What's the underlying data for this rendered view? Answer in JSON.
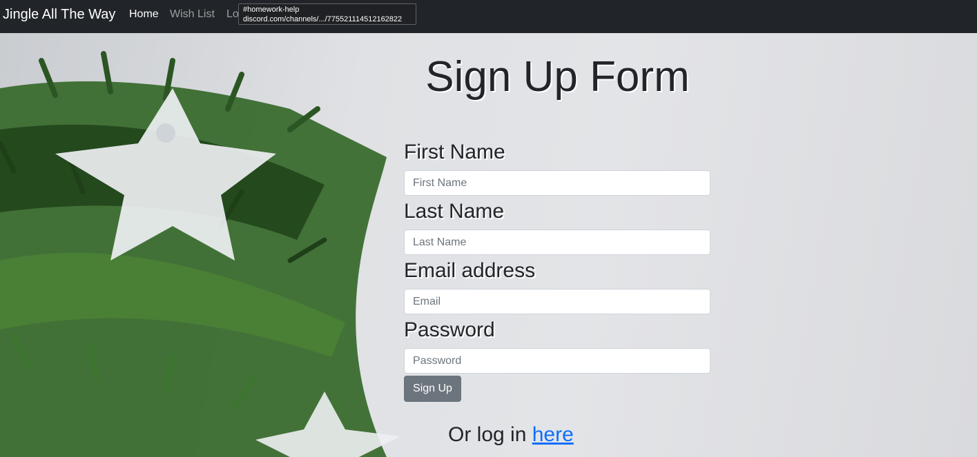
{
  "nav": {
    "brand": "Jingle All The Way",
    "links": [
      {
        "label": "Home",
        "active": true
      },
      {
        "label": "Wish List",
        "active": false
      },
      {
        "label": "Lo",
        "active": false
      }
    ]
  },
  "tooltip": {
    "line1": "#homework-help",
    "line2": "discord.com/channels/.../775521114512162822"
  },
  "form": {
    "title": "Sign Up Form",
    "first_name": {
      "label": "First Name",
      "placeholder": "First Name",
      "value": ""
    },
    "last_name": {
      "label": "Last Name",
      "placeholder": "Last Name",
      "value": ""
    },
    "email": {
      "label": "Email address",
      "placeholder": "Email",
      "value": ""
    },
    "password": {
      "label": "Password",
      "placeholder": "Password",
      "value": ""
    },
    "submit_label": "Sign Up"
  },
  "login": {
    "prefix": "Or log in ",
    "link_label": "here"
  },
  "colors": {
    "navbar": "#212529",
    "button": "#6c757d",
    "link": "#0d6efd",
    "pine": "#2f5a26"
  },
  "background": {
    "icons": [
      "pine-branch-icon",
      "star-ornament-icon"
    ]
  }
}
